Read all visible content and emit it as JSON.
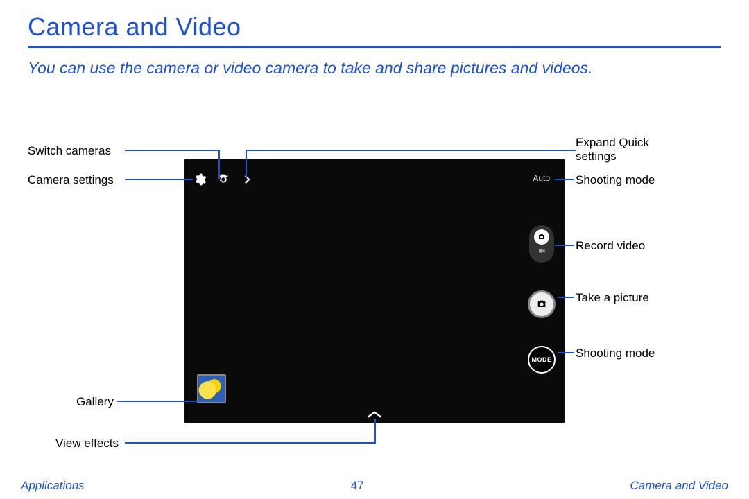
{
  "title": "Camera and Video",
  "intro": "You can use the camera or video camera to take and share pictures and videos.",
  "callouts": {
    "switch_cameras": "Switch cameras",
    "camera_settings": "Camera settings",
    "gallery": "Gallery",
    "view_effects": "View effects",
    "expand_quick_settings_l1": "Expand Quick",
    "expand_quick_settings_l2": "settings",
    "shooting_mode_top": "Shooting mode",
    "record_video": "Record video",
    "take_a_picture": "Take a picture",
    "shooting_mode_bottom": "Shooting mode"
  },
  "ui": {
    "auto_label": "Auto",
    "mode_label": "MODE"
  },
  "footer": {
    "left": "Applications",
    "page": "47",
    "right": "Camera and Video"
  }
}
